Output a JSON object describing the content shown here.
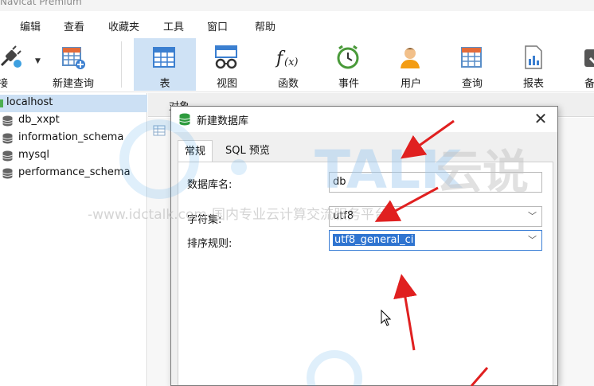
{
  "app": {
    "title": "Navicat Premium"
  },
  "menu": [
    "编辑",
    "查看",
    "收藏夹",
    "工具",
    "窗口",
    "帮助"
  ],
  "toolbar": {
    "connect": "连接",
    "new_query": "新建查询",
    "items": [
      "表",
      "视图",
      "函数",
      "事件",
      "用户",
      "查询",
      "报表",
      "备"
    ]
  },
  "sidebar": {
    "connection": "localhost",
    "databases": [
      "db_xxpt",
      "information_schema",
      "mysql",
      "performance_schema"
    ]
  },
  "object_tab": "对象",
  "dialog": {
    "title": "新建数据库",
    "tabs": [
      "常规",
      "SQL 预览"
    ],
    "fields": {
      "db_name_label": "数据库名:",
      "db_name_value": "db",
      "charset_label": "字符集:",
      "charset_value": "utf8",
      "collation_label": "排序规则:",
      "collation_value": "utf8_general_ci"
    }
  },
  "watermark": {
    "brand": "TALK",
    "brand_cn": "云说",
    "line": "-www.idctalk.com-国内专业云计算交流服务平台-"
  },
  "colors": {
    "active_tool": "#cfe2f5",
    "selection": "#2f74d0",
    "arrow": "#e02020"
  }
}
